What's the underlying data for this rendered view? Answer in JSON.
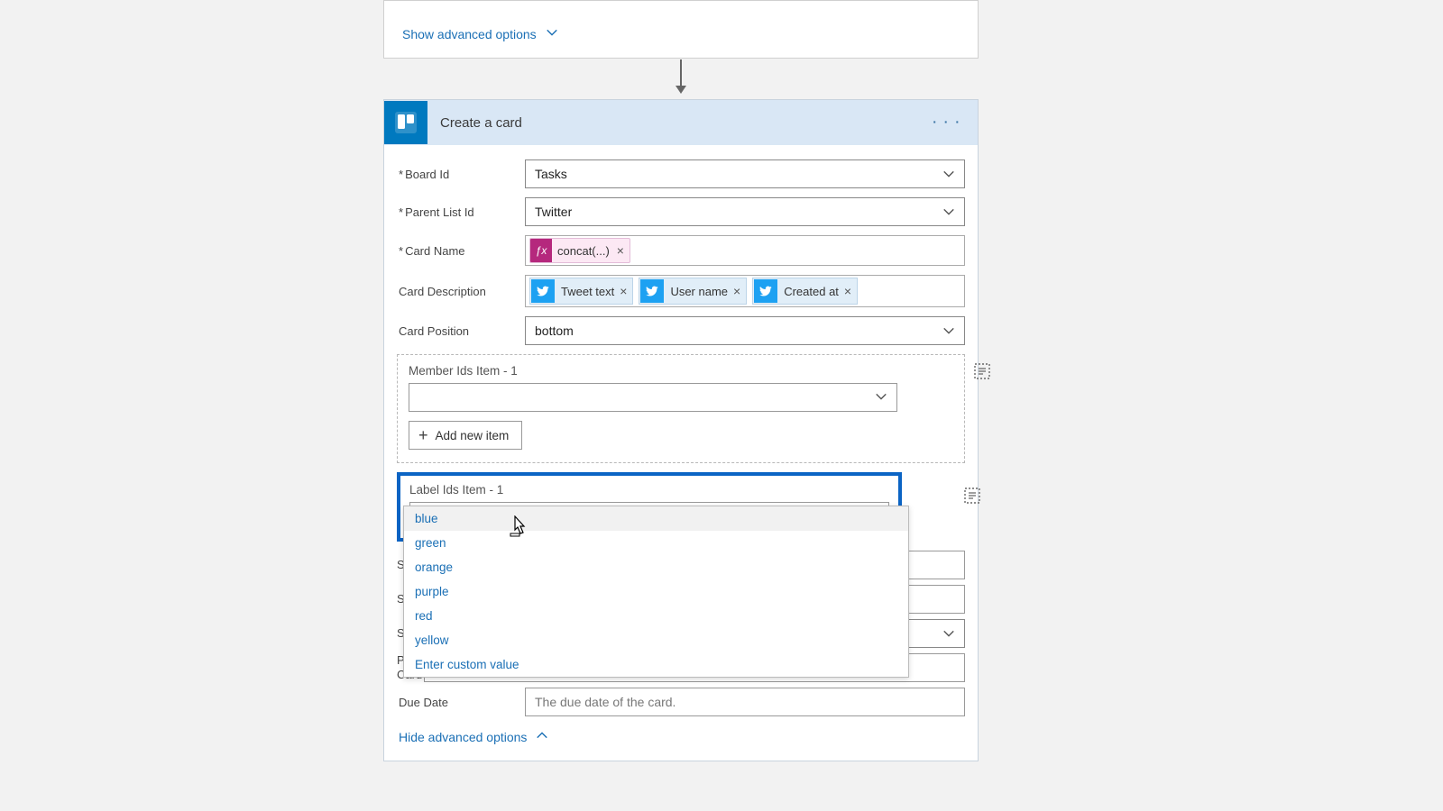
{
  "top_card": {
    "show_advanced": "Show advanced options"
  },
  "header": {
    "title": "Create a card"
  },
  "fields": {
    "board_id": {
      "label": "Board Id",
      "value": "Tasks"
    },
    "parent_list_id": {
      "label": "Parent List Id",
      "value": "Twitter"
    },
    "card_name": {
      "label": "Card Name",
      "token": "concat(...)"
    },
    "card_description": {
      "label": "Card Description",
      "tokens": [
        "Tweet text",
        "User name",
        "Created at"
      ]
    },
    "card_position": {
      "label": "Card Position",
      "value": "bottom"
    },
    "member_ids": {
      "label": "Member Ids Item - 1",
      "add_label": "Add new item"
    },
    "label_ids": {
      "label": "Label Ids Item - 1",
      "options": [
        "blue",
        "green",
        "orange",
        "purple",
        "red",
        "yellow",
        "Enter custom value"
      ]
    },
    "hidden": {
      "row1_prefix": "S",
      "row2_prefix": "S",
      "row3_prefix": "S",
      "row4_line1": "P",
      "row4_line2": "Card"
    },
    "due_date": {
      "label": "Due Date",
      "placeholder": "The due date of the card."
    }
  },
  "footer": {
    "hide_advanced": "Hide advanced options"
  }
}
